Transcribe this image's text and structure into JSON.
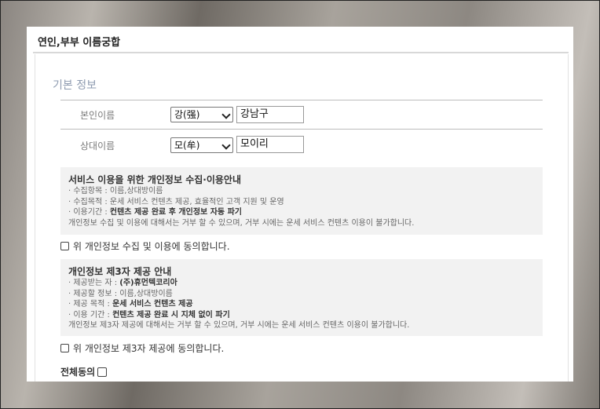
{
  "panel": {
    "title": "연인,부부 이름궁합"
  },
  "section": {
    "title": "기본 정보"
  },
  "self": {
    "label": "본인이름",
    "hanja": "강(强)",
    "name": "강남구"
  },
  "partner": {
    "label": "상대이름",
    "hanja": "모(牟)",
    "name": "모이리"
  },
  "privacy": {
    "title": "서비스 이용을 위한 개인정보 수집·이용안내",
    "items_label": "· 수집항목 : ",
    "items_value": "이름,상대방이름",
    "purpose_label": "· 수집목적 : ",
    "purpose_value": "운세 서비스 컨텐츠 제공, 효율적인 고객 지원 및 운영",
    "period_label": "· 이용기간 : ",
    "period_value": "컨텐츠 제공 완료 후 개인정보 자동 파기",
    "note": "개인정보 수집 및 이용에 대해서는 거부 할 수 있으며, 거부 시에는 운세 서비스 컨텐츠 이용이 불가합니다.",
    "agree": "위 개인정보 수집 및 이용에 동의합니다."
  },
  "third_party": {
    "title": "개인정보 제3자 제공 안내",
    "recipient_label": "· 제공받는 자 : ",
    "recipient_value": "(주)휴먼텍코리아",
    "info_label": "· 제공할 정보 : ",
    "info_value": "이름,상대방이름",
    "purpose_label": "· 제공 목적 : ",
    "purpose_value": "운세 서비스 컨텐츠 제공",
    "period_label": "· 이용 기간 : ",
    "period_value": "컨텐츠 제공 완료 시 지체 없이 파기",
    "note": "개인정보 제3자 제공에 대해서는 거부 할 수 있으며, 거부 시에는 운세 서비스 컨텐츠 이용이 불가합니다.",
    "agree": "위 개인정보 제3자 제공에 동의합니다."
  },
  "all_agree": {
    "label": "전체동의"
  }
}
